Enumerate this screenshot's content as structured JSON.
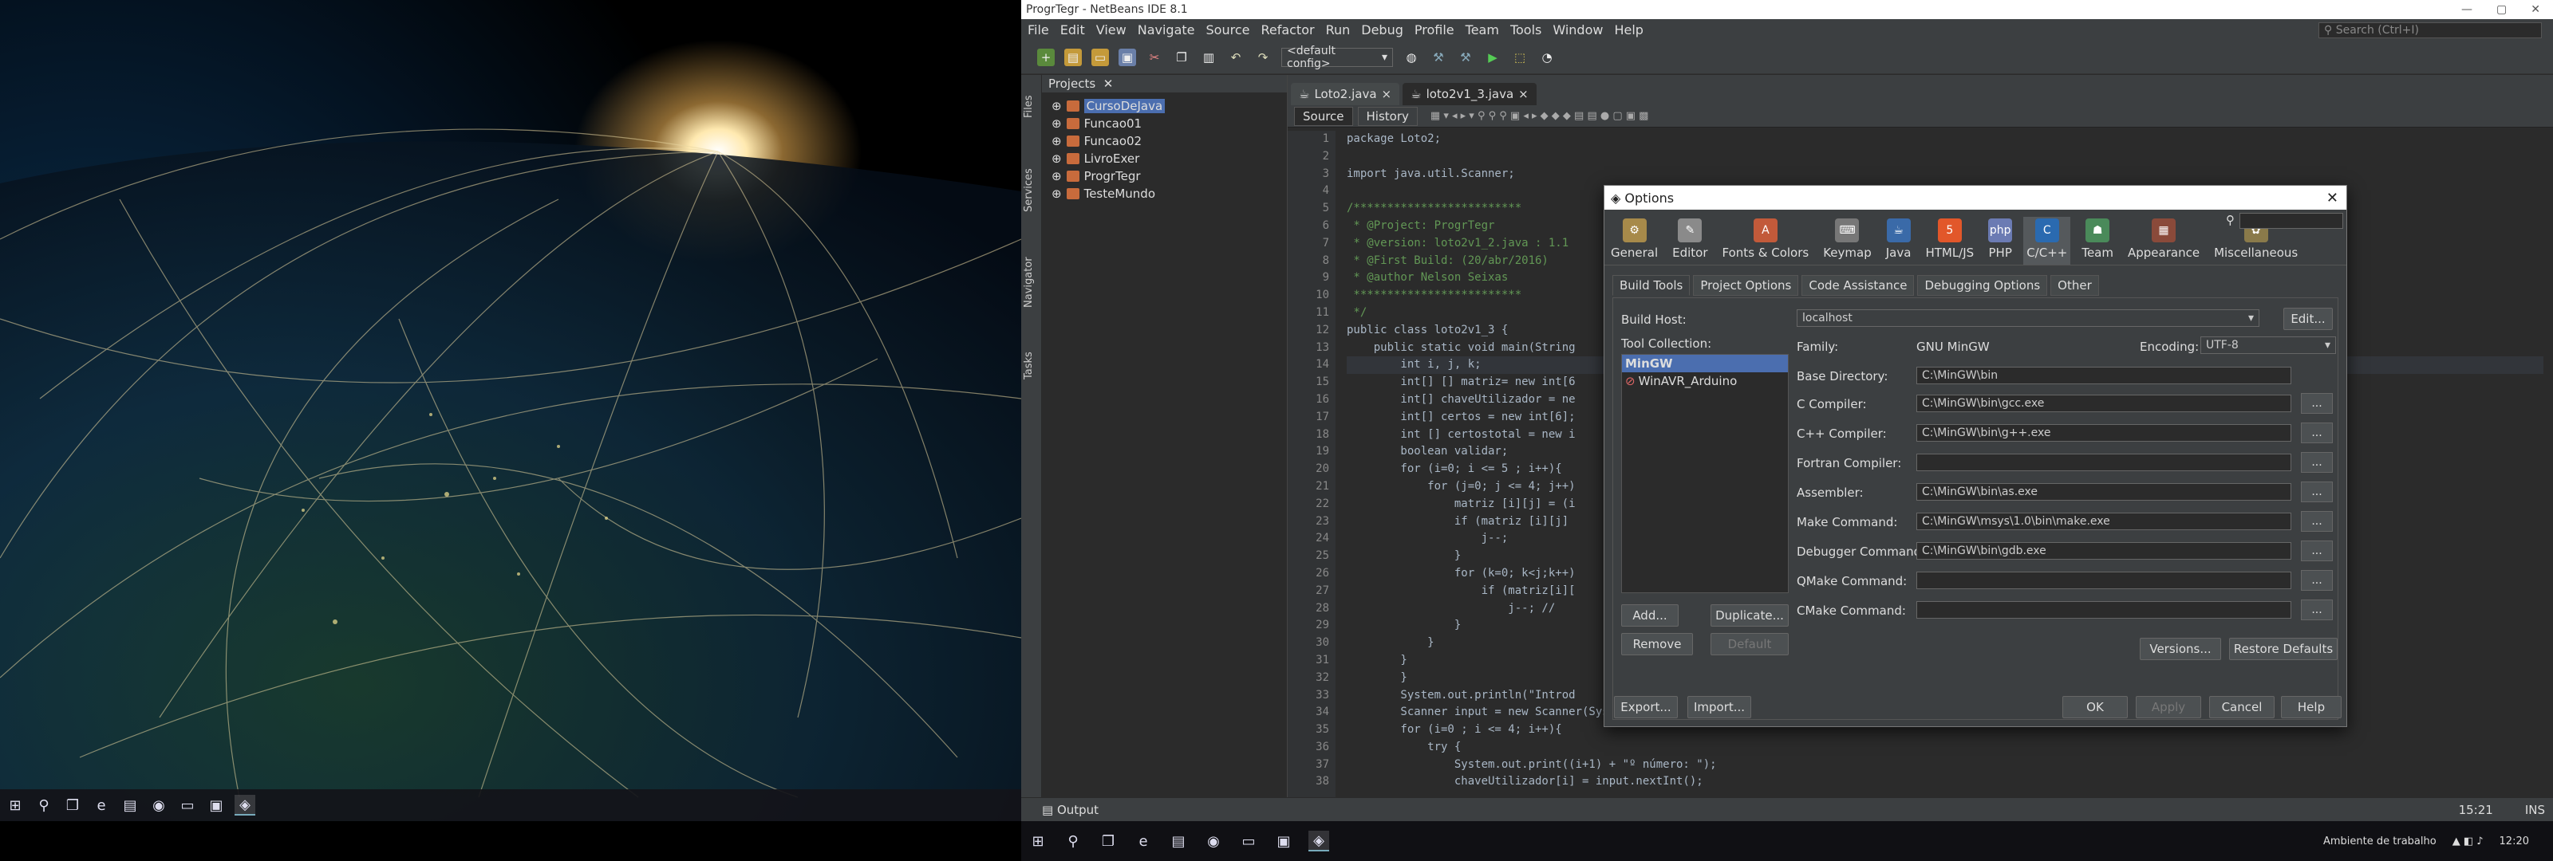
{
  "netbeans": {
    "window_title": "ProgrTegr - NetBeans IDE 8.1",
    "window_controls": [
      "—",
      "▢",
      "✕"
    ],
    "menu": [
      "File",
      "Edit",
      "View",
      "Navigate",
      "Source",
      "Refactor",
      "Run",
      "Debug",
      "Profile",
      "Team",
      "Tools",
      "Window",
      "Help"
    ],
    "search_placeholder": "Search (Ctrl+I)",
    "config": "<default config>",
    "side_tabs": [
      "Files",
      "Services",
      "Navigator",
      "Tasks"
    ],
    "projects_header": "Projects",
    "projects": [
      "CursoDeJava",
      "Funcao01",
      "Funcao02",
      "LivroExer",
      "ProgrTegr",
      "TesteMundo"
    ],
    "editor_tabs": [
      "Loto2.java",
      "loto2v1_3.java"
    ],
    "source_label": "Source",
    "history_label": "History",
    "line_numbers": [
      "1",
      "2",
      "3",
      "4",
      "5",
      "6",
      "7",
      "8",
      "9",
      "10",
      "11",
      "12",
      "13",
      "14",
      "15",
      "16",
      "17",
      "18",
      "19",
      "20",
      "21",
      "22",
      "23",
      "24",
      "25",
      "26",
      "27",
      "28",
      "29",
      "30",
      "31",
      "32",
      "33",
      "34",
      "35",
      "36",
      "37",
      "38"
    ],
    "code_lines": [
      "package Loto2;",
      "",
      "import java.util.Scanner;",
      "",
      "/*************************",
      " * @Project: ProgrTegr",
      " * @version: loto2v1_2.java : 1.1",
      " * @First Build: (20/abr/2016)",
      " * @author Nelson Seixas",
      " *************************",
      " */",
      "public class loto2v1_3 {",
      "    public static void main(String",
      "        int i, j, k;",
      "        int[] [] matriz= new int[6",
      "        int[] chaveUtilizador = ne",
      "        int[] certos = new int[6];",
      "        int [] certostotal = new i",
      "        boolean validar;",
      "        for (i=0; i <= 5 ; i++){",
      "            for (j=0; j <= 4; j++)",
      "                matriz [i][j] = (i",
      "                if (matriz [i][j]",
      "                    j--;",
      "                }",
      "                for (k=0; k<j;k++)",
      "                    if (matriz[i][",
      "                        j--; //",
      "                }",
      "            }",
      "        }",
      "        }",
      "        System.out.println(\"Introd",
      "        Scanner input = new Scanner(System.in);",
      "        for (i=0 ; i <= 4; i++){",
      "            try {",
      "                System.out.print((i+1) + \"º número: \");",
      "                chaveUtilizador[i] = input.nextInt();"
    ],
    "status_output": "Output",
    "status_position": "15:21",
    "status_mode": "INS"
  },
  "options_dialog": {
    "title": "Options",
    "close": "✕",
    "categories": [
      "General",
      "Editor",
      "Fonts & Colors",
      "Keymap",
      "Java",
      "HTML/JS",
      "PHP",
      "C/C++",
      "Team",
      "Appearance",
      "Miscellaneous"
    ],
    "selected_category": "C/C++",
    "subtabs": [
      "Build Tools",
      "Project Options",
      "Code Assistance",
      "Debugging Options",
      "Other"
    ],
    "build_host_label": "Build Host:",
    "build_host_value": "localhost",
    "edit_label": "Edit...",
    "tool_collection_label": "Tool Collection:",
    "tool_collections": [
      "MinGW",
      "WinAVR_Arduino"
    ],
    "family_label": "Family:",
    "family_value": "GNU MinGW",
    "encoding_label": "Encoding:",
    "encoding_value": "UTF-8",
    "fields": [
      {
        "label": "Base Directory:",
        "value": "C:\\MinGW\\bin"
      },
      {
        "label": "C Compiler:",
        "value": "C:\\MinGW\\bin\\gcc.exe"
      },
      {
        "label": "C++ Compiler:",
        "value": "C:\\MinGW\\bin\\g++.exe"
      },
      {
        "label": "Fortran Compiler:",
        "value": ""
      },
      {
        "label": "Assembler:",
        "value": "C:\\MinGW\\bin\\as.exe"
      },
      {
        "label": "Make Command:",
        "value": "C:\\MinGW\\msys\\1.0\\bin\\make.exe"
      },
      {
        "label": "Debugger Command:",
        "value": "C:\\MinGW\\bin\\gdb.exe"
      },
      {
        "label": "QMake Command:",
        "value": ""
      },
      {
        "label": "CMake Command:",
        "value": ""
      }
    ],
    "dots_label": "...",
    "add_label": "Add...",
    "duplicate_label": "Duplicate...",
    "remove_label": "Remove",
    "default_label": "Default",
    "versions_label": "Versions...",
    "restore_label": "Restore Defaults",
    "export_label": "Export...",
    "import_label": "Import...",
    "ok_label": "OK",
    "apply_label": "Apply",
    "cancel_label": "Cancel",
    "help_label": "Help"
  },
  "taskbar": {
    "tray_text": "Ambiente de trabalho",
    "clock": "12:20"
  }
}
